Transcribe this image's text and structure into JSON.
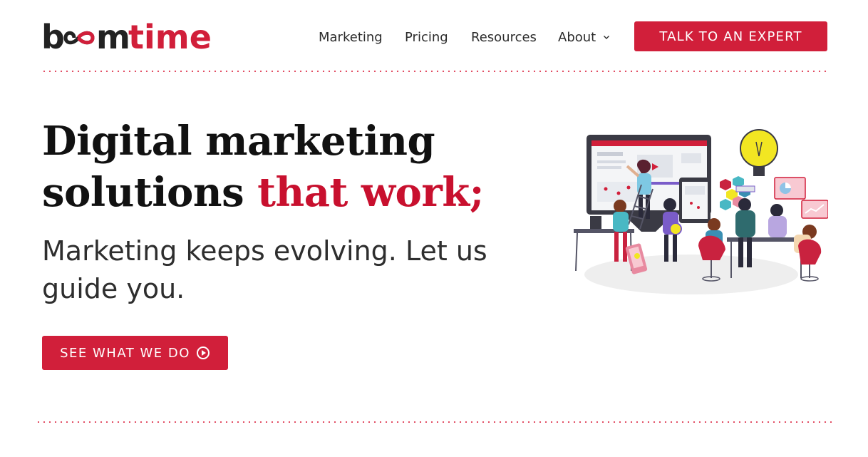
{
  "brand": {
    "logo_text_dark": "b",
    "logo_text_mid": "m",
    "logo_text_red": "time",
    "colors": {
      "dark": "#222222",
      "accent": "#d11f3a"
    }
  },
  "nav": {
    "items": [
      {
        "label": "Marketing"
      },
      {
        "label": "Pricing"
      },
      {
        "label": "Resources"
      },
      {
        "label": "About"
      }
    ],
    "cta_label": "TALK TO AN EXPERT"
  },
  "hero": {
    "headline_part1": "Digital marketing solutions ",
    "headline_accent": "that work;",
    "subheadline": "Marketing keeps evolving. Let us guide you.",
    "cta_label": "SEE WHAT WE DO"
  },
  "icons": {
    "about_chevron": "chevron-down-icon",
    "hero_cta": "play-circle-icon",
    "logo_infinity": "infinity-icon"
  }
}
